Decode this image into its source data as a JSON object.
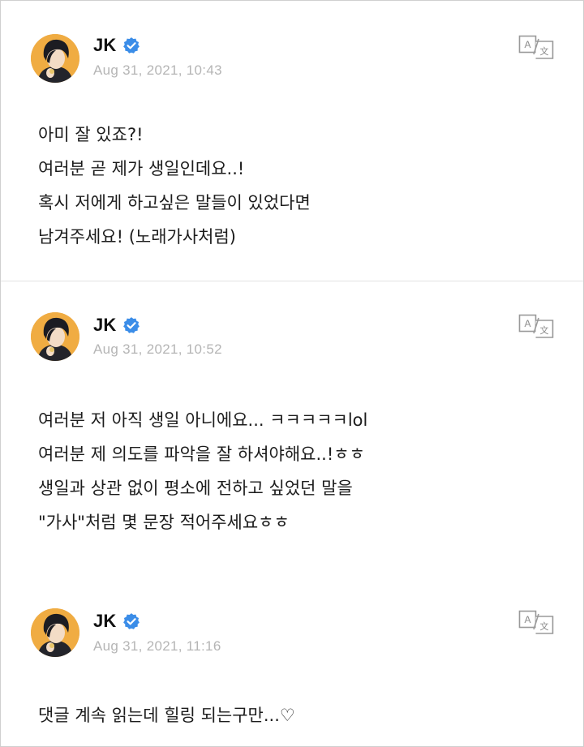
{
  "posts": [
    {
      "author": "JK",
      "timestamp": "Aug 31, 2021, 10:43",
      "lines": [
        "아미 잘 있죠?!",
        "여러분 곧 제가 생일인데요..!",
        "혹시 저에게 하고싶은 말들이 있었다면",
        "남겨주세요! (노래가사처럼)"
      ]
    },
    {
      "author": "JK",
      "timestamp": "Aug 31, 2021, 10:52",
      "lines": [
        "여러분 저 아직 생일 아니에요... ㅋㅋㅋㅋㅋlol",
        "여러분 제 의도를 파악을 잘 하셔야해요..!ㅎㅎ",
        "생일과 상관 없이 평소에 전하고 싶었던 말을",
        "\"가사\"처럼 몇 문장 적어주세요ㅎㅎ"
      ]
    },
    {
      "author": "JK",
      "timestamp": "Aug 31, 2021, 11:16",
      "lines": [
        "댓글 계속 읽는데 힐링 되는구만...♡"
      ]
    }
  ],
  "icons": {
    "verified": "verified-badge-icon",
    "translate": "translate-icon"
  },
  "colors": {
    "verified_blue": "#3b8de8",
    "timestamp_gray": "#b5b5b5",
    "icon_gray": "#9a9a9a",
    "divider": "#e2e2e2"
  }
}
